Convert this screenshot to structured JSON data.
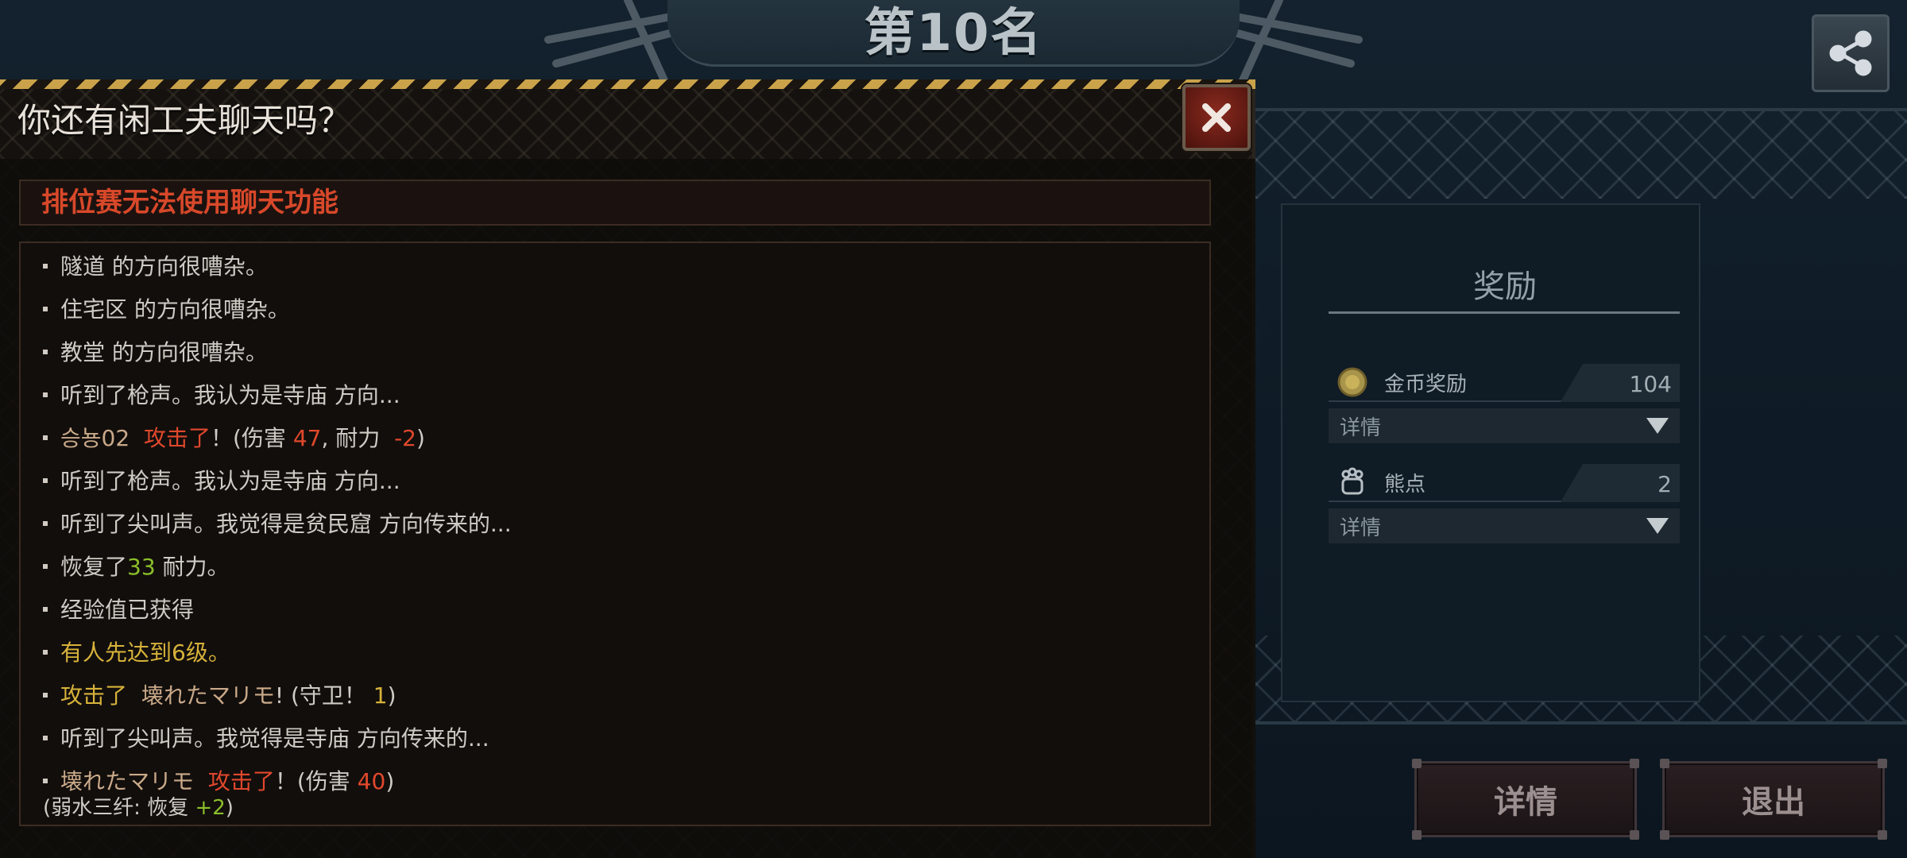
{
  "header": {
    "rank_title": "第10名"
  },
  "share": {
    "icon": "share-icon"
  },
  "rewards": {
    "title": "奖励",
    "items": [
      {
        "icon": "coin-icon",
        "label": "金币奖励",
        "value": "104",
        "detail_label": "详情"
      },
      {
        "icon": "bear-paw-icon",
        "label": "熊点",
        "value": "2",
        "detail_label": "详情"
      }
    ]
  },
  "buttons": {
    "details": "详情",
    "exit": "退出"
  },
  "chat": {
    "title": "你还有闲工夫聊天吗？",
    "warning": "排位赛无法使用聊天功能",
    "log": [
      {
        "text": "隧道 的方向很嘈杂。"
      },
      {
        "text": "住宅区 的方向很嘈杂。"
      },
      {
        "text": "教堂 的方向很嘈杂。"
      },
      {
        "text": "听到了枪声。我认为是寺庙 方向..."
      },
      {
        "player": "승뇽02",
        "action": "攻击了",
        "mid": "！(伤害 ",
        "damage": "47",
        "sep": ", 耐力 ",
        "stamina": "-2",
        "end": ")"
      },
      {
        "text": "听到了枪声。我认为是寺庙 方向..."
      },
      {
        "text": "听到了尖叫声。我觉得是贫民窟 方向传来的..."
      },
      {
        "pre": "恢复了",
        "amount": "33",
        "post": " 耐力。"
      },
      {
        "text": "经验值已获得"
      },
      {
        "gold_text": "有人先达到6级。"
      },
      {
        "attack_label": "攻击了",
        "target": "壊れたマリモ",
        "mid": "! (守卫！ ",
        "count": "1",
        "end": ")"
      },
      {
        "text": "听到了尖叫声。我觉得是寺庙 方向传来的..."
      },
      {
        "player": "壊れたマリモ",
        "action": "攻击了",
        "mid": "！(伤害 ",
        "damage": "40",
        "end": ")",
        "sub_pre": "(弱水三纤: 恢复 ",
        "sub_amount": "+2",
        "sub_end": ")"
      }
    ]
  },
  "colors": {
    "warning_red": "#d8482a",
    "damage_red": "#e0482c",
    "heal_green": "#8bbf2a",
    "gold": "#d6b23a"
  }
}
